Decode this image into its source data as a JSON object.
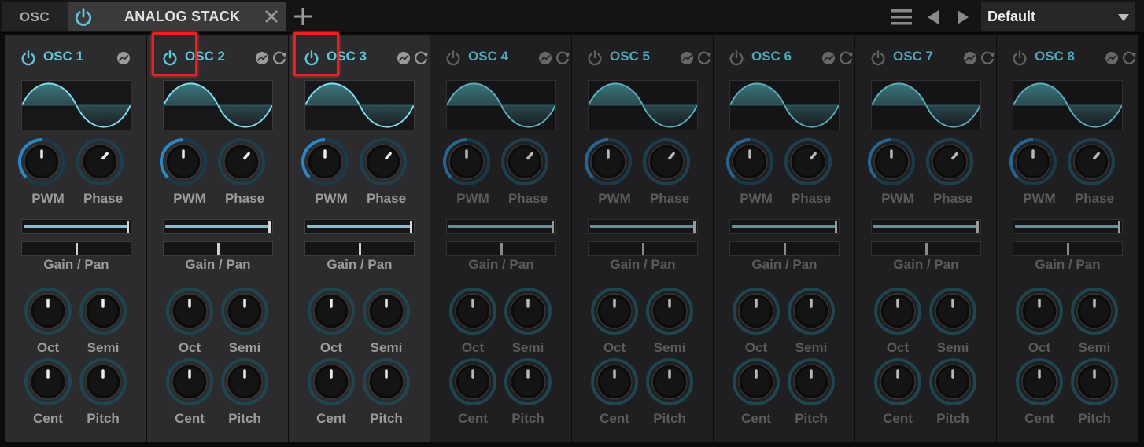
{
  "topbar": {
    "module_tab": "OSC",
    "stack_tab_title": "ANALOG STACK",
    "preset": "Default",
    "icons": [
      "power-icon",
      "close-icon",
      "plus-icon",
      "menu-icon",
      "arrow-left-icon",
      "arrow-right-icon",
      "dropdown-arrow-icon"
    ]
  },
  "colors": {
    "accent": "#5fc7dc",
    "knob_ring_blue": "#2d86c4",
    "knob_ring_teal": "#3e7c8c",
    "highlight_red": "#e8231f",
    "active_bg": "#2c2c2f",
    "inactive_bg": "#1f1f21"
  },
  "oscillators": [
    {
      "title": "OSC 1",
      "enabled": true,
      "highlighted": false,
      "has_reset": false
    },
    {
      "title": "OSC 2",
      "enabled": true,
      "highlighted": true,
      "has_reset": true
    },
    {
      "title": "OSC 3",
      "enabled": true,
      "highlighted": true,
      "has_reset": true
    },
    {
      "title": "OSC 4",
      "enabled": false,
      "highlighted": false,
      "has_reset": true
    },
    {
      "title": "OSC 5",
      "enabled": false,
      "highlighted": false,
      "has_reset": true
    },
    {
      "title": "OSC 6",
      "enabled": false,
      "highlighted": false,
      "has_reset": true
    },
    {
      "title": "OSC 7",
      "enabled": false,
      "highlighted": false,
      "has_reset": true
    },
    {
      "title": "OSC 8",
      "enabled": false,
      "highlighted": false,
      "has_reset": true
    }
  ],
  "labels": {
    "pwm": "PWM",
    "phase": "Phase",
    "gain_pan": "Gain / Pan",
    "oct": "Oct",
    "semi": "Semi",
    "cent": "Cent",
    "pitch": "Pitch"
  },
  "knob_values": {
    "pwm": 0.5,
    "phase": 0.65,
    "oct": 0.5,
    "semi": 0.5,
    "cent": 0.5,
    "pitch": 0.5
  },
  "slider_values": {
    "gain": 1.0,
    "pan": 0.5
  }
}
